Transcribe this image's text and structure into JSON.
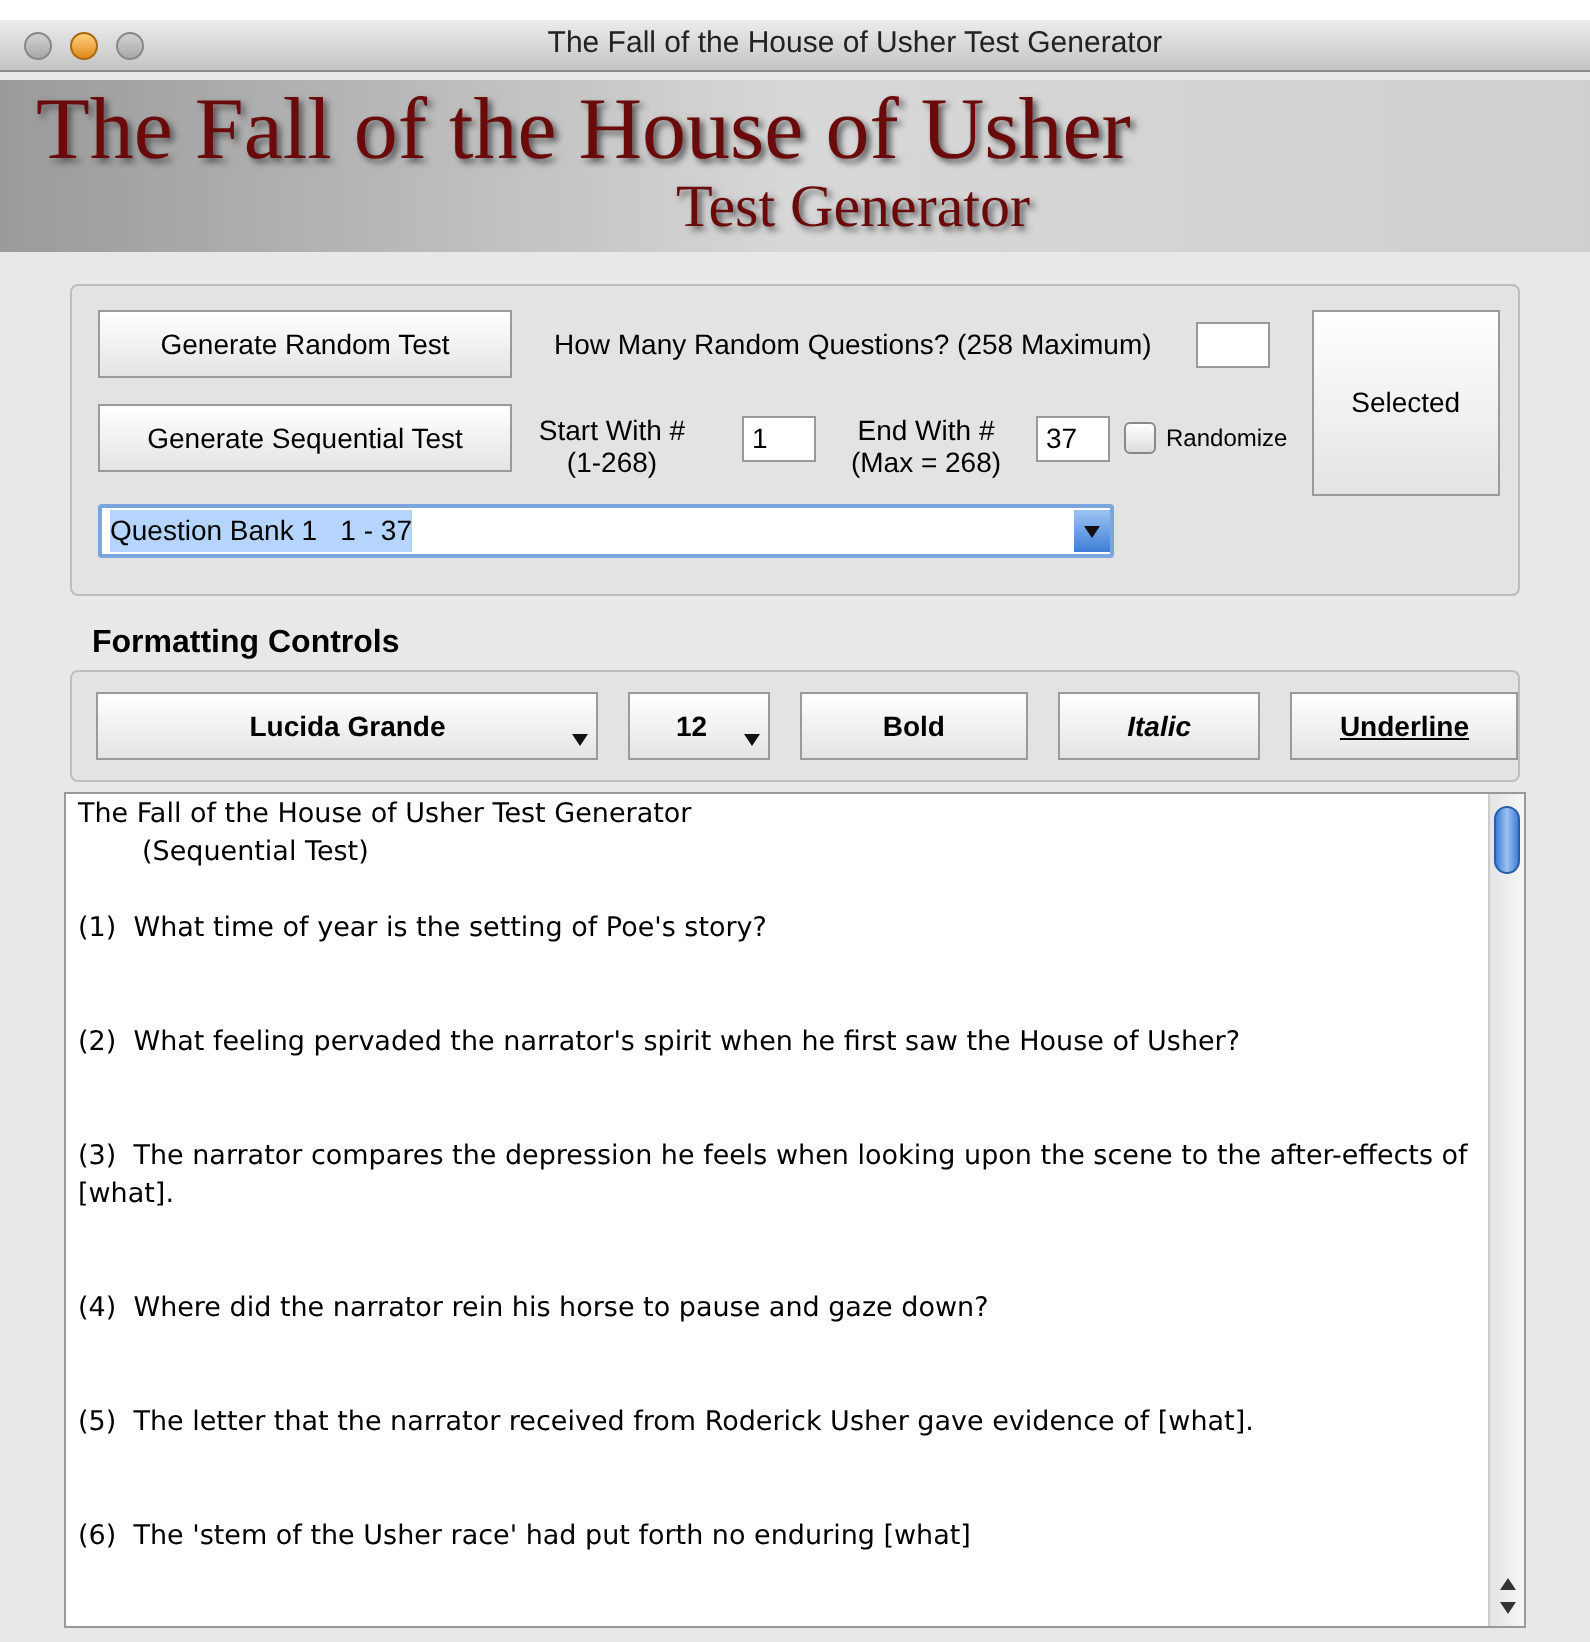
{
  "window": {
    "title": "The Fall of the House of Usher Test Generator"
  },
  "banner": {
    "title": "The Fall of the House of Usher",
    "subtitle": "Test Generator"
  },
  "generator": {
    "random_button": "Generate Random Test",
    "random_count_label": "How Many Random Questions? (258 Maximum)",
    "sequential_button": "Generate Sequential Test",
    "start": {
      "label": "Start With #",
      "range": "(1-268)",
      "value": "1"
    },
    "end": {
      "label": "End With #",
      "range": "(Max = 268)",
      "value": "37"
    },
    "randomize": {
      "label": "Randomize",
      "checked": false
    },
    "selected_button": "Selected",
    "question_bank": {
      "value": "Question Bank 1   1 - 37"
    }
  },
  "formatting": {
    "title": "Formatting Controls",
    "font": "Lucida Grande",
    "size": "12",
    "buttons": [
      {
        "label": "Bold",
        "kind": "bold"
      },
      {
        "label": "Italic",
        "kind": "italic"
      },
      {
        "label": "Underline",
        "kind": "underline"
      }
    ]
  },
  "document": {
    "heading": "The Fall of the House of Usher Test Generator",
    "subheading": "(Sequential Test)",
    "questions": [
      {
        "number": "(1)",
        "text": "What time of year is the setting of Poe's story?"
      },
      {
        "number": "(2)",
        "text": "What feeling pervaded the narrator's spirit when he first saw the House of Usher?"
      },
      {
        "number": "(3)",
        "text": "The narrator compares the depression he feels when looking upon the scene to the after-effects of [what]."
      },
      {
        "number": "(4)",
        "text": "Where did the narrator rein his horse to pause and gaze down?"
      },
      {
        "number": "(5)",
        "text": "The letter that the narrator received from Roderick Usher gave evidence of [what]."
      },
      {
        "number": "(6)",
        "text": "The 'stem of the Usher race' had put forth no enduring [what]"
      }
    ]
  }
}
